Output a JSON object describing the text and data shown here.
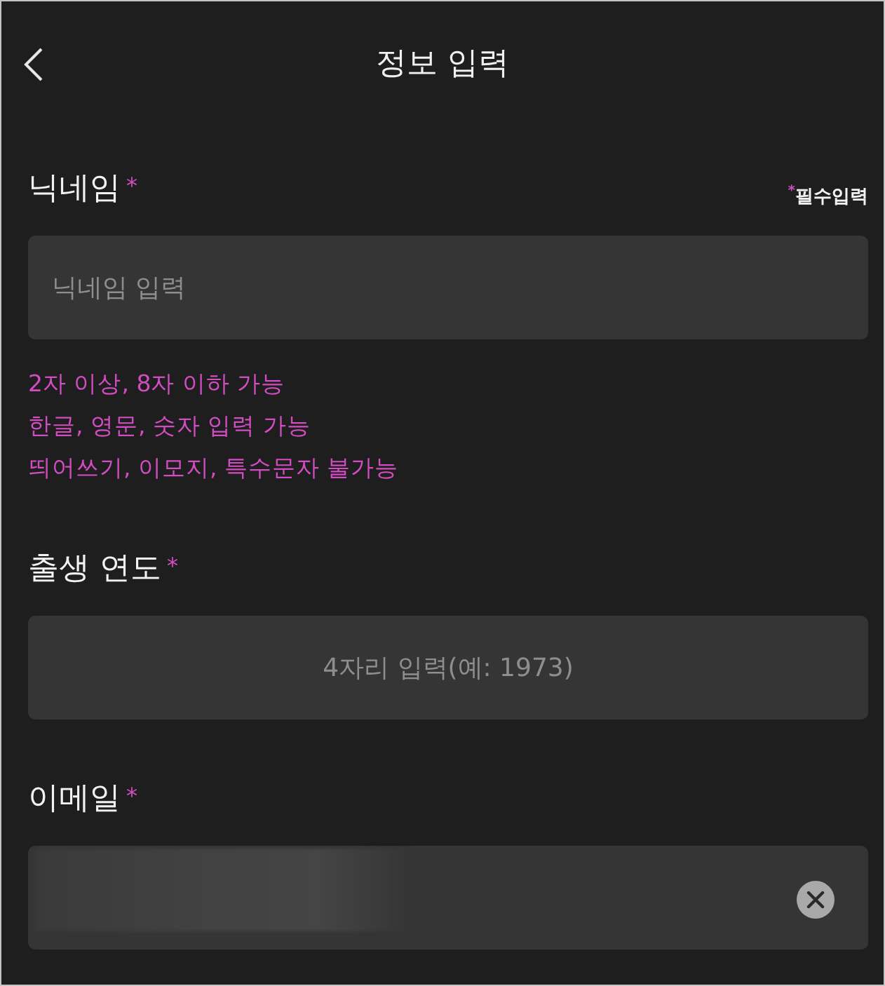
{
  "header": {
    "title": "정보 입력"
  },
  "required_note": {
    "mark": "*",
    "text": "필수입력"
  },
  "fields": [
    {
      "kind": "text",
      "label": "닉네임",
      "mark": "*",
      "placeholder": "닉네임 입력",
      "hints": [
        "2자 이상, 8자 이하 가능",
        "한글, 영문, 숫자 입력 가능",
        "띄어쓰기, 이모지, 특수문자 불가능"
      ]
    },
    {
      "kind": "number",
      "label": "출생 연도",
      "mark": "*",
      "placeholder": "4자리 입력(예: 1973)"
    },
    {
      "kind": "email",
      "label": "이메일",
      "mark": "*",
      "value_blurred": true,
      "clearable": true
    }
  ]
}
